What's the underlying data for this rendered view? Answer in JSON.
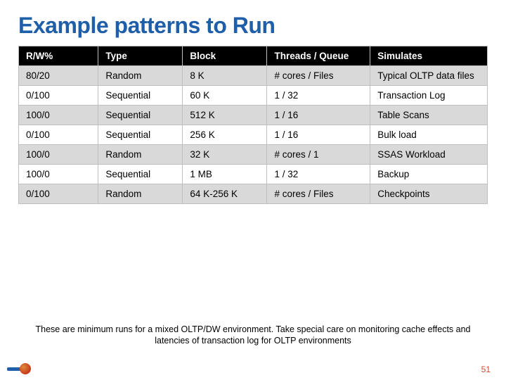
{
  "title": "Example patterns to Run",
  "columns": [
    "R/W%",
    "Type",
    "Block",
    "Threads / Queue",
    "Simulates"
  ],
  "rows": [
    {
      "rw": "80/20",
      "type": "Random",
      "block": "8 K",
      "tq": "# cores / Files",
      "sim": "Typical OLTP data files"
    },
    {
      "rw": "0/100",
      "type": "Sequential",
      "block": "60 K",
      "tq": "1 / 32",
      "sim": "Transaction Log"
    },
    {
      "rw": "100/0",
      "type": "Sequential",
      "block": "512 K",
      "tq": "1 / 16",
      "sim": "Table Scans"
    },
    {
      "rw": "0/100",
      "type": "Sequential",
      "block": "256 K",
      "tq": "1 / 16",
      "sim": "Bulk load"
    },
    {
      "rw": "100/0",
      "type": "Random",
      "block": "32 K",
      "tq": "# cores / 1",
      "sim": "SSAS Workload"
    },
    {
      "rw": "100/0",
      "type": "Sequential",
      "block": "1 MB",
      "tq": "1 / 32",
      "sim": "Backup"
    },
    {
      "rw": "0/100",
      "type": "Random",
      "block": "64 K-256 K",
      "tq": "# cores / Files",
      "sim": "Checkpoints"
    }
  ],
  "footnote": "These are minimum runs for a mixed OLTP/DW environment. Take special care on monitoring cache effects and latencies of transaction log for OLTP environments",
  "page_number": "51"
}
